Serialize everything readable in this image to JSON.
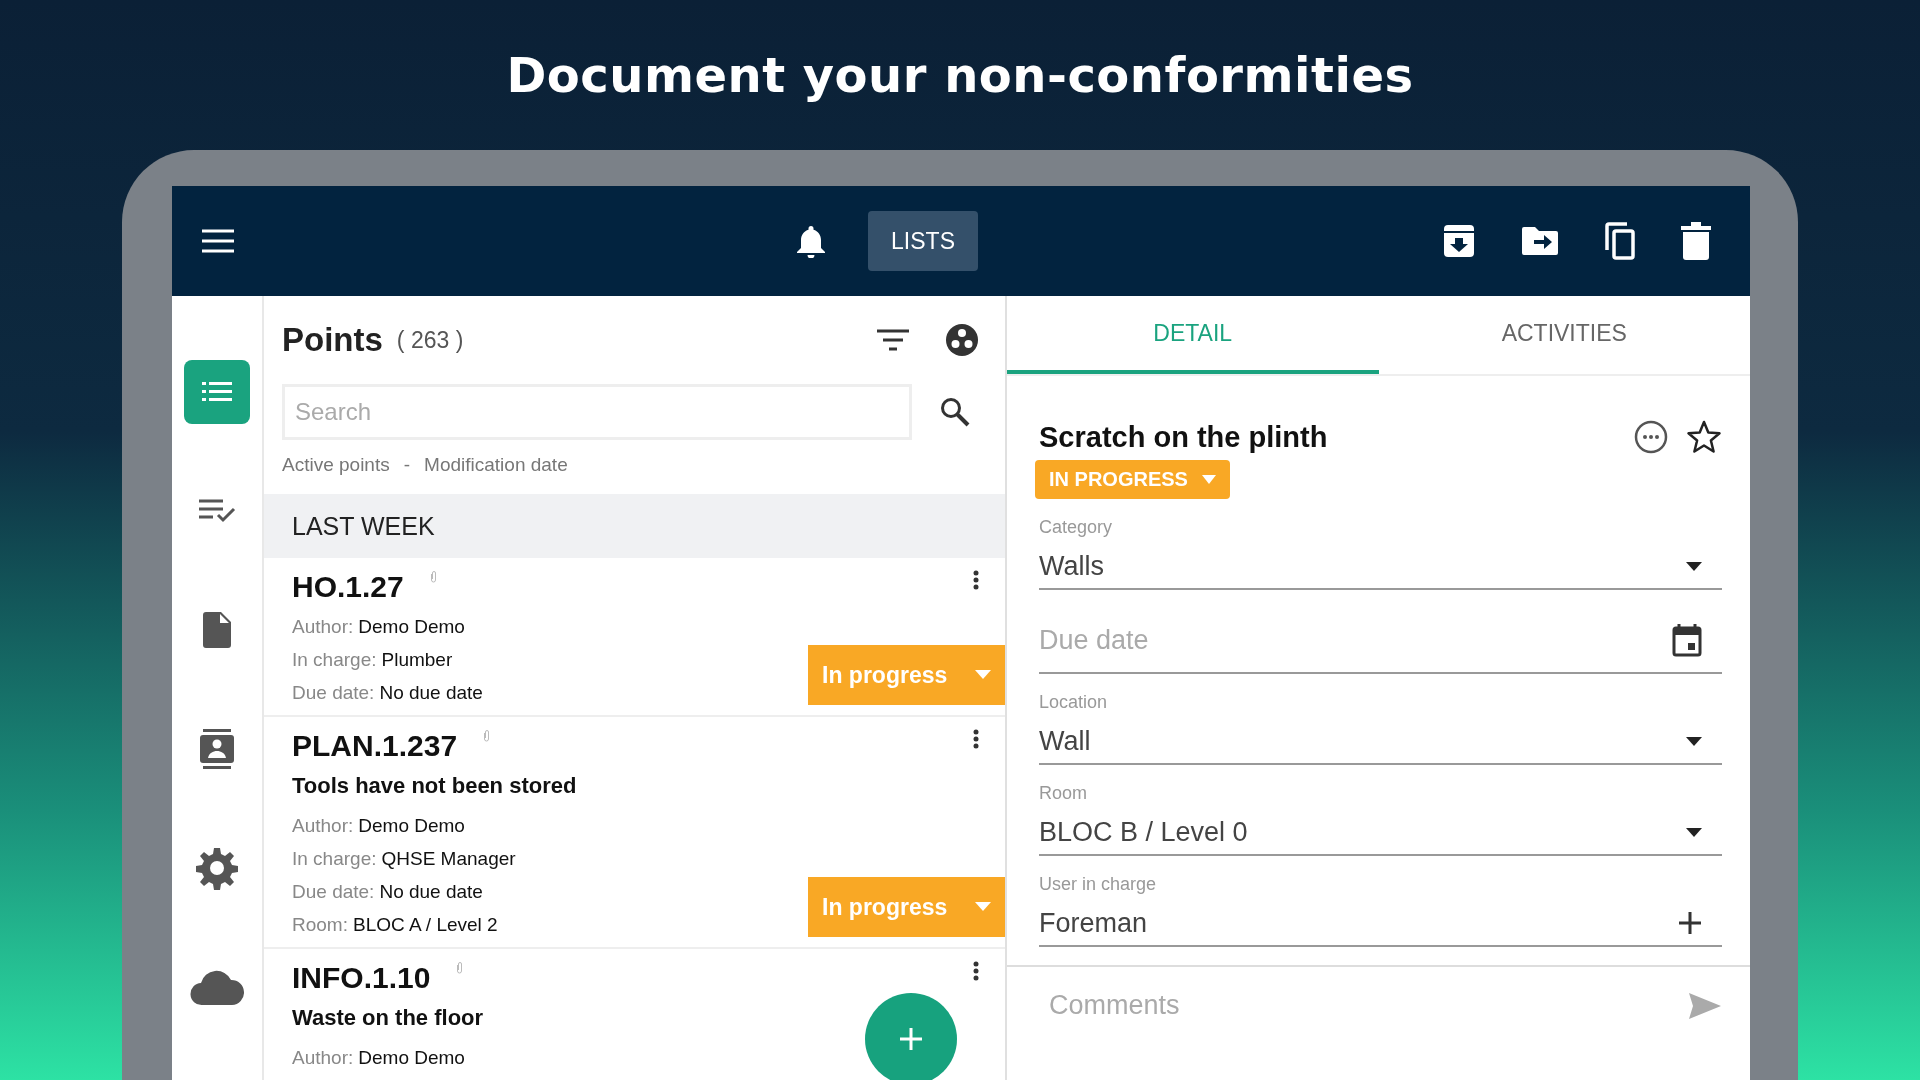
{
  "headline": "Document your non-conformities",
  "toolbar": {
    "lists_button": "LISTS"
  },
  "sidebar": {
    "items": [
      {
        "kind": "list",
        "selected": true
      },
      {
        "kind": "checklist",
        "selected": false
      },
      {
        "kind": "document",
        "selected": false
      },
      {
        "kind": "contacts",
        "selected": false
      },
      {
        "kind": "settings",
        "selected": false
      },
      {
        "kind": "cloud",
        "selected": false
      }
    ]
  },
  "points": {
    "title": "Points",
    "count": "( 263 )",
    "search": {
      "placeholder": "Search"
    },
    "filter": "Active points",
    "separator": "-",
    "sort": "Modification date",
    "group": "LAST WEEK",
    "cards": [
      {
        "code": "HO.1.27",
        "fields": [
          {
            "label": "Author:",
            "value": "Demo Demo"
          },
          {
            "label": "In charge:",
            "value": "Plumber"
          },
          {
            "label": "Due date:",
            "value": "No due date"
          }
        ],
        "status": "In progress"
      },
      {
        "code": "PLAN.1.237",
        "title": "Tools have not been stored",
        "fields": [
          {
            "label": "Author:",
            "value": "Demo Demo"
          },
          {
            "label": "In charge:",
            "value": "QHSE Manager"
          },
          {
            "label": "Due date:",
            "value": "No due date"
          },
          {
            "label": "Room:",
            "value": "BLOC A / Level 2"
          }
        ],
        "status": "In progress"
      },
      {
        "code": "INFO.1.10",
        "title": "Waste on the floor",
        "fields": [
          {
            "label": "Author:",
            "value": "Demo Demo"
          }
        ]
      }
    ]
  },
  "detail": {
    "tabs": [
      {
        "label": "DETAIL",
        "selected": true
      },
      {
        "label": "ACTIVITIES",
        "selected": false
      }
    ],
    "title": "Scratch on the plinth",
    "status": "IN PROGRESS",
    "fields": [
      {
        "kind": "select",
        "label": "Category",
        "value": "Walls"
      },
      {
        "kind": "date",
        "placeholder": "Due date"
      },
      {
        "kind": "select",
        "label": "Location",
        "value": "Wall"
      },
      {
        "kind": "select",
        "label": "Room",
        "value": "BLOC B / Level 0"
      },
      {
        "kind": "add",
        "label": "User in charge",
        "value": "Foreman"
      }
    ],
    "comments": {
      "placeholder": "Comments"
    }
  }
}
